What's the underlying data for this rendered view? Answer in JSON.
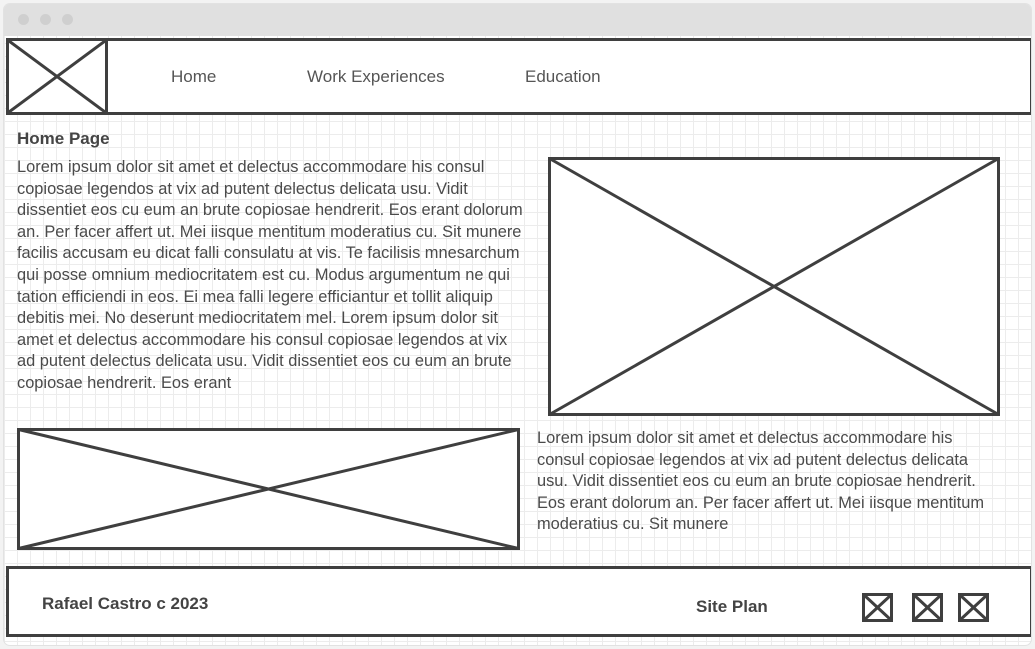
{
  "nav": {
    "items": [
      {
        "label": "Home"
      },
      {
        "label": "Work Experiences"
      },
      {
        "label": "Education"
      }
    ]
  },
  "main": {
    "title": "Home Page",
    "paragraph_1": "Lorem ipsum dolor sit amet et delectus accommodare his consul copiosae legendos at vix ad putent delectus delicata usu. Vidit dissentiet eos cu eum an brute copiosae hendrerit. Eos erant dolorum an. Per facer affert ut. Mei iisque mentitum moderatius cu. Sit munere facilis accusam eu dicat falli consulatu at vis. Te facilisis mnesarchum qui posse omnium mediocritatem est cu. Modus argumentum ne qui tation efficiendi in eos. Ei mea falli legere efficiantur et tollit aliquip debitis mei. No deserunt mediocritatem mel. Lorem ipsum dolor sit amet et delectus accommodare his consul copiosae legendos at vix ad putent delectus delicata usu. Vidit dissentiet eos cu eum an brute copiosae hendrerit. Eos erant",
    "paragraph_2": "Lorem ipsum dolor sit amet et delectus accommodare his consul copiosae legendos at vix ad putent delectus delicata usu. Vidit dissentiet eos cu eum an brute copiosae hendrerit. Eos erant dolorum an. Per facer affert ut. Mei iisque mentitum moderatius cu. Sit munere"
  },
  "footer": {
    "credit": "Rafael Castro c 2023",
    "site_plan": "Site Plan",
    "social_icons": [
      "image-placeholder-icon",
      "image-placeholder-icon",
      "image-placeholder-icon"
    ]
  },
  "colors": {
    "stroke": "#3f3f3f",
    "text": "#444444",
    "grid": "#ececec"
  }
}
